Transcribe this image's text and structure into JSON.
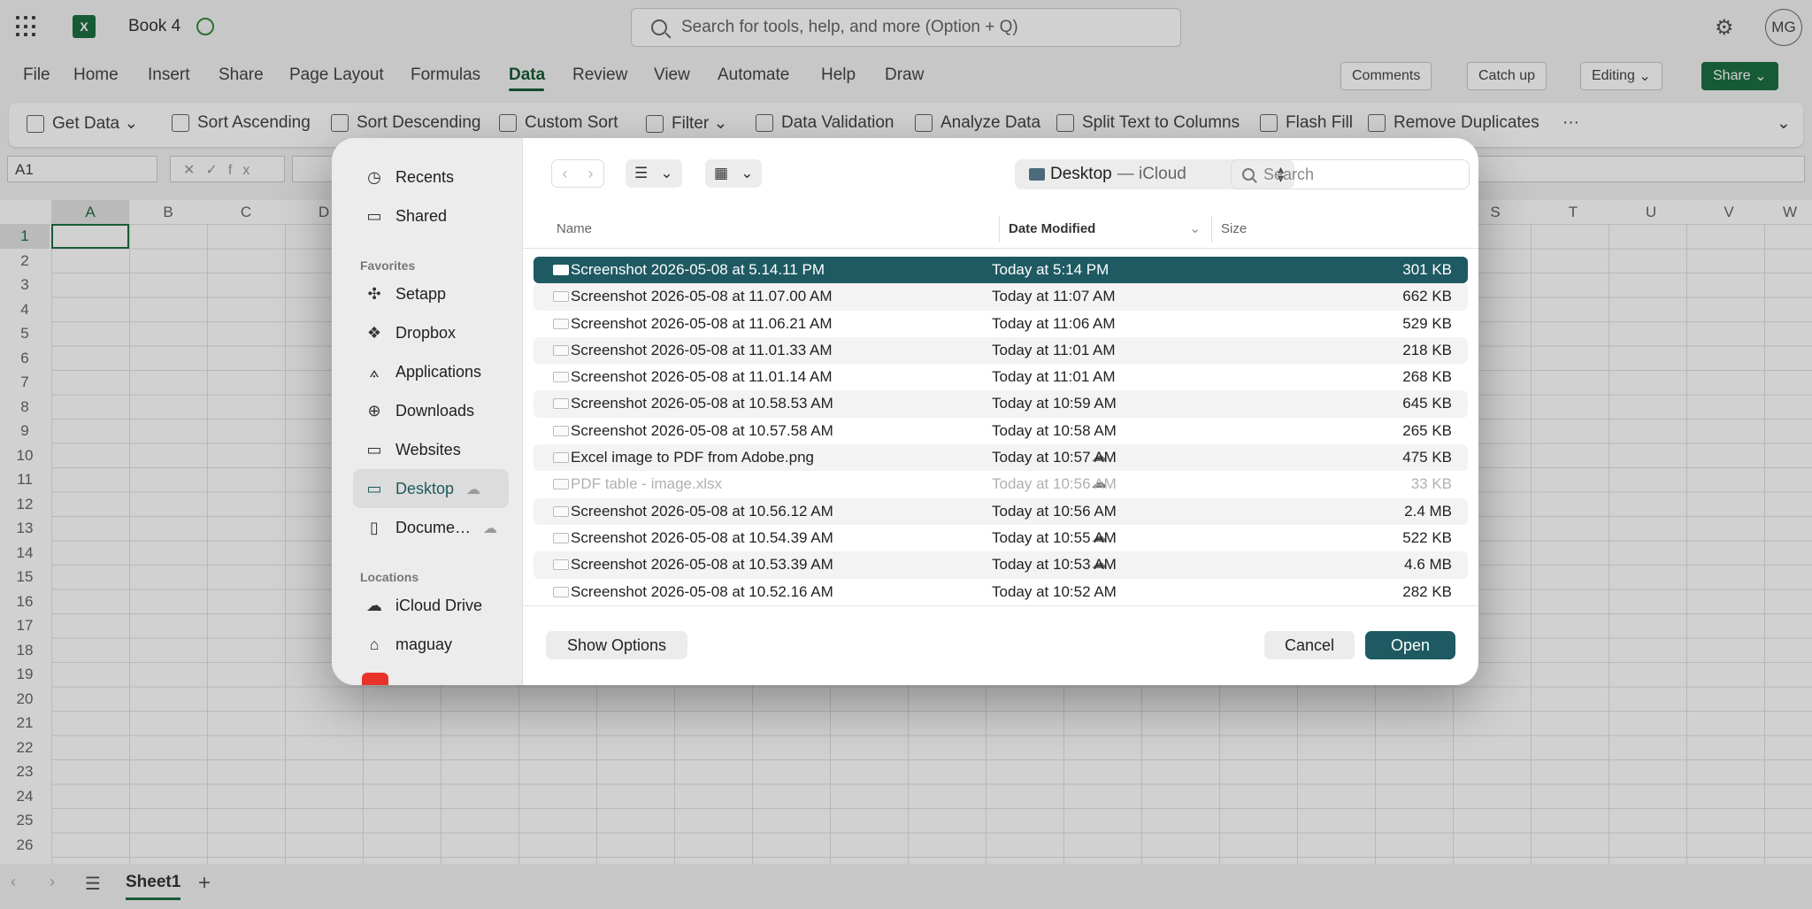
{
  "app": {
    "book_title": "Book 4",
    "search_placeholder": "Search for tools, help, and more (Option + Q)",
    "avatar_initials": "MG",
    "menu": [
      "File",
      "Home",
      "Insert",
      "Share",
      "Page Layout",
      "Formulas",
      "Data",
      "Review",
      "View",
      "Automate",
      "Help",
      "Draw"
    ],
    "active_menu": "Data",
    "right_buttons": {
      "comments": "Comments",
      "catchup": "Catch up",
      "editing": "Editing",
      "share": "Share"
    },
    "ribbon": [
      "Get Data",
      "Sort Ascending",
      "Sort Descending",
      "Custom Sort",
      "Filter",
      "Data Validation",
      "Analyze Data",
      "Split Text to Columns",
      "Flash Fill",
      "Remove Duplicates"
    ],
    "name_box": "A1",
    "fx_label": "fx",
    "columns": [
      "A",
      "B",
      "C",
      "D",
      "S",
      "T",
      "U",
      "V",
      "W"
    ],
    "rows": [
      "1",
      "2",
      "3",
      "4",
      "5",
      "6",
      "7",
      "8",
      "9",
      "10",
      "11",
      "12",
      "13",
      "14",
      "15",
      "16",
      "17",
      "18",
      "19",
      "20",
      "21",
      "22",
      "23",
      "24",
      "25",
      "26"
    ],
    "sheet_tab": "Sheet1"
  },
  "dialog": {
    "sidebar": {
      "top": [
        {
          "label": "Recents",
          "icon": "clock-icon"
        },
        {
          "label": "Shared",
          "icon": "shared-folder-icon"
        }
      ],
      "favorites_title": "Favorites",
      "favorites": [
        {
          "label": "Setapp",
          "icon": "setapp-icon"
        },
        {
          "label": "Dropbox",
          "icon": "dropbox-icon"
        },
        {
          "label": "Applications",
          "icon": "applications-icon"
        },
        {
          "label": "Downloads",
          "icon": "downloads-icon"
        },
        {
          "label": "Websites",
          "icon": "folder-icon"
        },
        {
          "label": "Desktop",
          "icon": "desktop-icon"
        },
        {
          "label": "Docume…",
          "icon": "document-icon"
        }
      ],
      "locations_title": "Locations",
      "locations": [
        {
          "label": "iCloud Drive",
          "icon": "cloud-icon"
        },
        {
          "label": "maguay",
          "icon": "home-icon"
        }
      ]
    },
    "location": "Desktop",
    "location_sub": "— iCloud",
    "search_placeholder": "Search",
    "columns": {
      "name": "Name",
      "date": "Date Modified",
      "size": "Size"
    },
    "files": [
      {
        "name": "Screenshot 2026-05-08 at 5.14.11 PM",
        "date": "Today at 5:14 PM",
        "size": "301 KB",
        "selected": true,
        "cloud": false,
        "dimmed": false
      },
      {
        "name": "Screenshot 2026-05-08 at 11.07.00 AM",
        "date": "Today at 11:07 AM",
        "size": "662 KB",
        "selected": false,
        "cloud": false,
        "dimmed": false
      },
      {
        "name": "Screenshot 2026-05-08 at 11.06.21 AM",
        "date": "Today at 11:06 AM",
        "size": "529 KB",
        "selected": false,
        "cloud": false,
        "dimmed": false
      },
      {
        "name": "Screenshot 2026-05-08 at 11.01.33 AM",
        "date": "Today at 11:01 AM",
        "size": "218 KB",
        "selected": false,
        "cloud": false,
        "dimmed": false
      },
      {
        "name": "Screenshot 2026-05-08 at 11.01.14 AM",
        "date": "Today at 11:01 AM",
        "size": "268 KB",
        "selected": false,
        "cloud": false,
        "dimmed": false
      },
      {
        "name": "Screenshot 2026-05-08 at 10.58.53 AM",
        "date": "Today at 10:59 AM",
        "size": "645 KB",
        "selected": false,
        "cloud": false,
        "dimmed": false
      },
      {
        "name": "Screenshot 2026-05-08 at 10.57.58 AM",
        "date": "Today at 10:58 AM",
        "size": "265 KB",
        "selected": false,
        "cloud": false,
        "dimmed": false
      },
      {
        "name": "Excel image to PDF from Adobe.png",
        "date": "Today at 10:57 AM",
        "size": "475 KB",
        "selected": false,
        "cloud": true,
        "dimmed": false
      },
      {
        "name": "PDF table - image.xlsx",
        "date": "Today at 10:56 AM",
        "size": "33 KB",
        "selected": false,
        "cloud": true,
        "dimmed": true
      },
      {
        "name": "Screenshot 2026-05-08 at 10.56.12 AM",
        "date": "Today at 10:56 AM",
        "size": "2.4 MB",
        "selected": false,
        "cloud": false,
        "dimmed": false
      },
      {
        "name": "Screenshot 2026-05-08 at 10.54.39 AM",
        "date": "Today at 10:55 AM",
        "size": "522 KB",
        "selected": false,
        "cloud": true,
        "dimmed": false
      },
      {
        "name": "Screenshot 2026-05-08 at 10.53.39 AM",
        "date": "Today at 10:53 AM",
        "size": "4.6 MB",
        "selected": false,
        "cloud": true,
        "dimmed": false
      },
      {
        "name": "Screenshot 2026-05-08 at 10.52.16 AM",
        "date": "Today at 10:52 AM",
        "size": "282 KB",
        "selected": false,
        "cloud": false,
        "dimmed": false
      }
    ],
    "show_options": "Show Options",
    "cancel": "Cancel",
    "open": "Open"
  },
  "colors": {
    "excel_green": "#1d6f42",
    "dialog_accent": "#1f5a63"
  }
}
